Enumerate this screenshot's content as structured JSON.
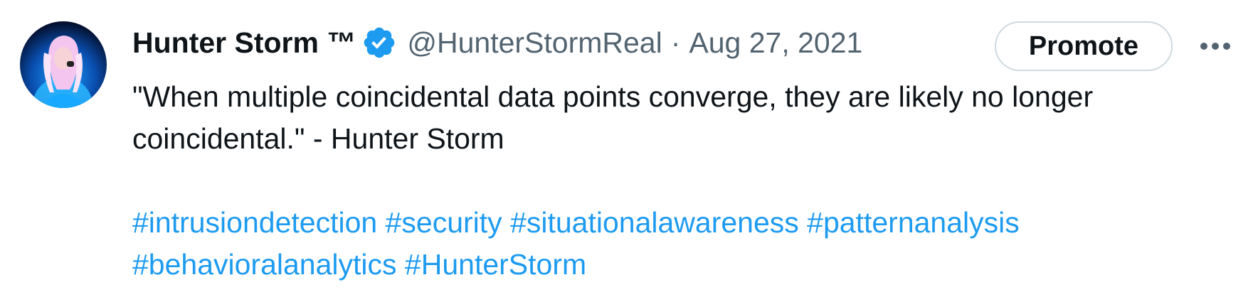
{
  "tweet": {
    "author": {
      "display_name": "Hunter Storm ™",
      "handle": "@HunterStormReal",
      "verified": true,
      "verified_icon": "verified-badge-icon",
      "avatar_icon": "avatar"
    },
    "separator": "·",
    "date": "Aug 27, 2021",
    "promote_label": "Promote",
    "more_icon": "more-horizontal-icon",
    "text_lines": [
      "\"When multiple coincidental data points converge, they are likely no longer",
      "coincidental.\" - Hunter Storm"
    ],
    "hashtags": [
      "#intrusiondetection",
      "#security",
      "#situationalawareness",
      "#patternanalysis",
      "#behavioralanalytics",
      "#HunterStorm"
    ]
  },
  "colors": {
    "link": "#1d9bf0",
    "text": "#0f1419",
    "secondary": "#536471",
    "border": "#cfd9de"
  }
}
